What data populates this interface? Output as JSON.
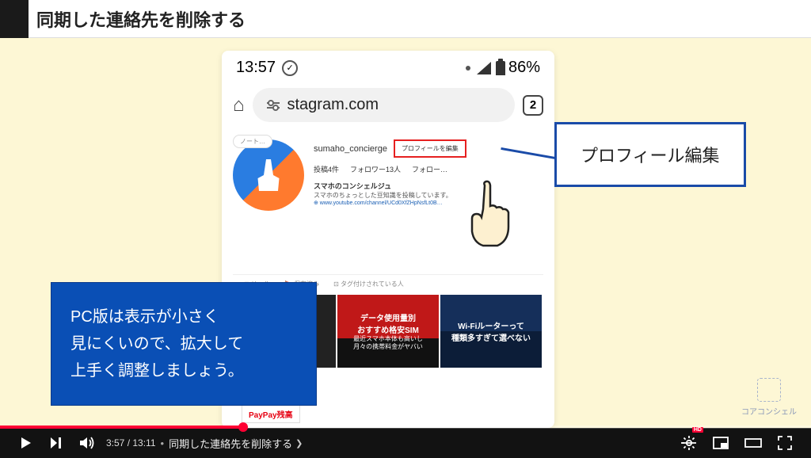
{
  "title": "同期した連絡先を削除する",
  "phone": {
    "time": "13:57",
    "battery_pct": "86%",
    "url_text": "stagram.com",
    "tab_count": "2",
    "note_badge": "ノート…",
    "username": "sumaho_concierge",
    "edit_button": "プロフィールを編集",
    "stats": {
      "posts": "投稿4件",
      "followers": "フォロワー13人",
      "following": "フォロー…"
    },
    "bio": {
      "name": "スマホのコンシェルジュ",
      "line": "スマホのちょっとした豆知識を投稿しています。",
      "link": "⊕ www.youtube.com/channel/UCd0XfZHpNsfLt0B…"
    },
    "tabs": {
      "reels": "⊞ リール",
      "saved": "🔖 保存済み",
      "tagged": "⊡ タグ付けされている人"
    },
    "tiles": {
      "t1a": "データ使用量別",
      "t1b": "おすすめ格安SIM",
      "t1c": "最近スマホ本体も高いし",
      "t1d": "月々の携帯料金がヤバい",
      "t2a": "Wi-Fiルーターって",
      "t2b": "種類多すぎて選べない",
      "paypay": "PayPay残高"
    }
  },
  "callout": "プロフィール編集",
  "info_box": {
    "l1": "PC版は表示が小さく",
    "l2": "見にくいので、拡大して",
    "l3": "上手く調整しましょう。"
  },
  "logo_text": "コアコンシェル",
  "player": {
    "current": "3:57",
    "total": "13:11",
    "chapter": "同期した連絡先を削除する",
    "hd": "HD"
  }
}
